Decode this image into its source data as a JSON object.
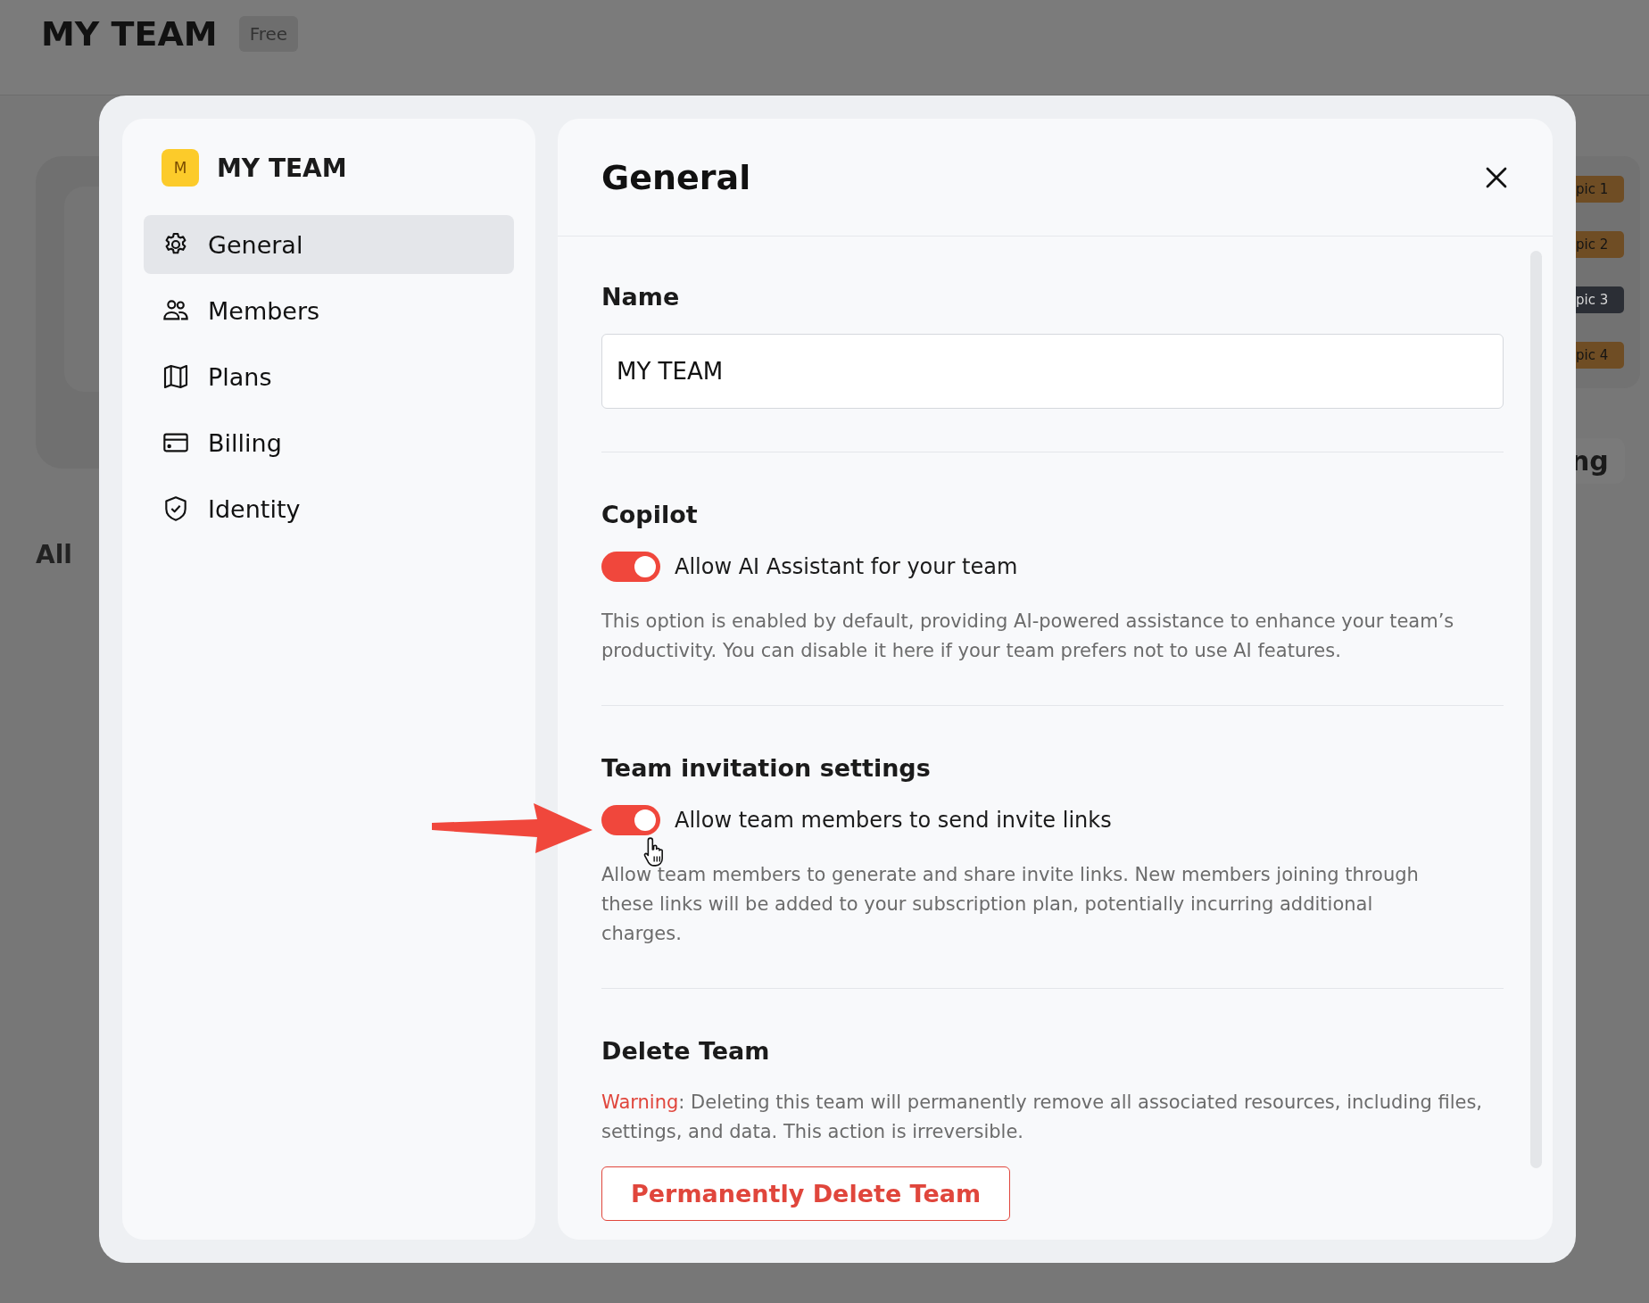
{
  "page": {
    "title": "MY TEAM",
    "plan_badge": "Free",
    "filter_label": "All",
    "tab_fragment": "ng",
    "topic_badges": [
      {
        "label": "pic 1",
        "color": "#6f4d24"
      },
      {
        "label": "pic 2",
        "color": "#6f4d24"
      },
      {
        "label": "pic 3",
        "color": "#2b2e35"
      },
      {
        "label": "pic 4",
        "color": "#6f4d24"
      }
    ]
  },
  "modal": {
    "sidebar": {
      "avatar_letter": "M",
      "team_name": "MY TEAM",
      "items": [
        {
          "label": "General",
          "kind": "gear",
          "selected": true
        },
        {
          "label": "Members",
          "kind": "people",
          "selected": false
        },
        {
          "label": "Plans",
          "kind": "map",
          "selected": false
        },
        {
          "label": "Billing",
          "kind": "card",
          "selected": false
        },
        {
          "label": "Identity",
          "kind": "shield",
          "selected": false
        }
      ]
    },
    "title": "General",
    "name_section": {
      "heading": "Name",
      "value": "MY TEAM"
    },
    "copilot": {
      "heading": "Copilot",
      "toggle_label": "Allow AI Assistant for your team",
      "on": true,
      "description": "This option is enabled by default, providing AI-powered assistance to enhance your team’s productivity. You can disable it here if your team prefers not to use AI features."
    },
    "invitations": {
      "heading": "Team invitation settings",
      "toggle_label": "Allow team members to send invite links",
      "on": true,
      "description": "Allow team members to generate and share invite links. New members joining through these links will be added to your subscription plan, potentially incurring additional charges."
    },
    "delete": {
      "heading": "Delete Team",
      "warning_label": "Warning",
      "warning_text": ": Deleting this team will permanently remove all associated resources, including files, settings, and data. This action is irreversible.",
      "button": "Permanently Delete Team"
    }
  }
}
